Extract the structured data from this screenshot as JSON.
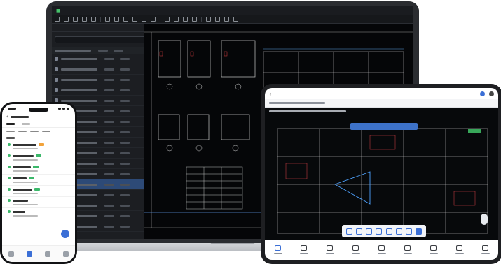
{
  "laptop": {
    "app_title": "",
    "sidebar": {
      "tabs": [
        "",
        ""
      ],
      "search_placeholder": "",
      "selected_row": 12,
      "row_count": 17
    }
  },
  "tablet": {
    "title": "",
    "subtitle": "",
    "tip": "",
    "nav_items": 9,
    "active_nav": 0
  },
  "phone": {
    "title": "",
    "list_items": 7
  },
  "colors": {
    "accent": "#3b6fd6",
    "cad_background": "#050608",
    "brand": "#46c26a"
  }
}
